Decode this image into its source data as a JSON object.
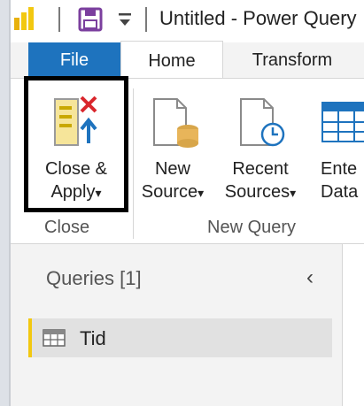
{
  "titlebar": {
    "title": "Untitled - Power Query"
  },
  "tabs": {
    "file": "File",
    "home": "Home",
    "transform": "Transform"
  },
  "ribbon": {
    "close_apply_line1": "Close &",
    "close_apply_line2": "Apply",
    "new_source_line1": "New",
    "new_source_line2": "Source",
    "recent_sources_line1": "Recent",
    "recent_sources_line2": "Sources",
    "enter_data_line1": "Ente",
    "enter_data_line2": "Data",
    "dropdown_glyph": "▾",
    "group_close": "Close",
    "group_new_query": "New Query"
  },
  "queries": {
    "title": "Queries [1]",
    "collapse_glyph": "‹",
    "items": [
      {
        "label": "Tid"
      }
    ]
  },
  "colors": {
    "file_tab": "#1e73be",
    "accent_yellow": "#f2c811",
    "save_icon": "#7b3f9e"
  }
}
